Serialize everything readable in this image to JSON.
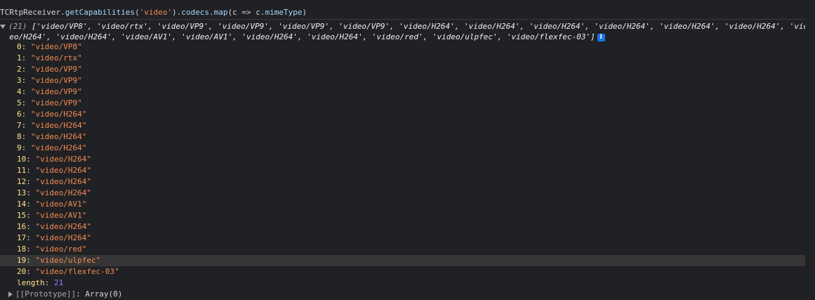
{
  "console": {
    "input": {
      "obj": "TCRtpReceiver",
      "method": "getCapabilities",
      "arg": "'video'",
      "chain": "codecs",
      "map": "map",
      "param": "c",
      "arrow": "=>",
      "target": "c",
      "prop": "mimeType"
    },
    "result": {
      "count": "(21)",
      "preview_line1": "['video/VP8', 'video/rtx', 'video/VP9', 'video/VP9', 'video/VP9', 'video/VP9', 'video/H264', 'video/H264', 'video/H264', 'video/H264', 'video/H264', 'video/H264', 'vid",
      "preview_line2": "eo/H264', 'video/H264', 'video/AV1', 'video/AV1', 'video/H264', 'video/H264', 'video/red', 'video/ulpfec', 'video/flexfec-03']",
      "info_icon": "i",
      "items": [
        {
          "key": "0",
          "value": "\"video/VP8\""
        },
        {
          "key": "1",
          "value": "\"video/rtx\""
        },
        {
          "key": "2",
          "value": "\"video/VP9\""
        },
        {
          "key": "3",
          "value": "\"video/VP9\""
        },
        {
          "key": "4",
          "value": "\"video/VP9\""
        },
        {
          "key": "5",
          "value": "\"video/VP9\""
        },
        {
          "key": "6",
          "value": "\"video/H264\""
        },
        {
          "key": "7",
          "value": "\"video/H264\""
        },
        {
          "key": "8",
          "value": "\"video/H264\""
        },
        {
          "key": "9",
          "value": "\"video/H264\""
        },
        {
          "key": "10",
          "value": "\"video/H264\""
        },
        {
          "key": "11",
          "value": "\"video/H264\""
        },
        {
          "key": "12",
          "value": "\"video/H264\""
        },
        {
          "key": "13",
          "value": "\"video/H264\""
        },
        {
          "key": "14",
          "value": "\"video/AV1\""
        },
        {
          "key": "15",
          "value": "\"video/AV1\""
        },
        {
          "key": "16",
          "value": "\"video/H264\""
        },
        {
          "key": "17",
          "value": "\"video/H264\""
        },
        {
          "key": "18",
          "value": "\"video/red\""
        },
        {
          "key": "19",
          "value": "\"video/ulpfec\""
        },
        {
          "key": "20",
          "value": "\"video/flexfec-03\""
        }
      ],
      "highlighted_index": 19,
      "length_label": "length",
      "length_value": "21",
      "prototype_label": "[[Prototype]]",
      "prototype_value": "Array(0)"
    }
  }
}
